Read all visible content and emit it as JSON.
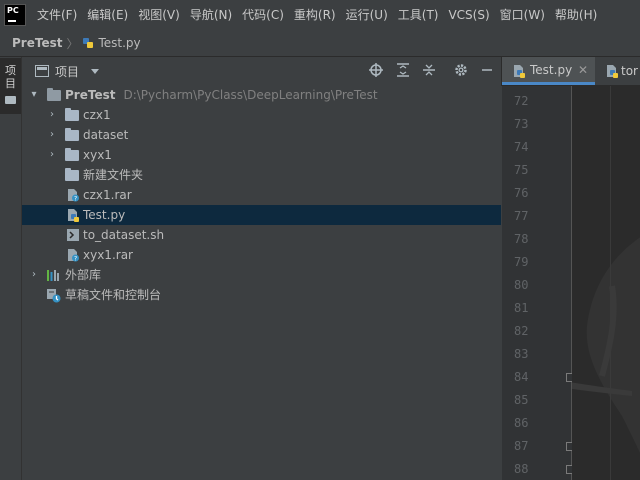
{
  "menubar": {
    "logo_text": "PC",
    "items": [
      "文件(F)",
      "编辑(E)",
      "视图(V)",
      "导航(N)",
      "代码(C)",
      "重构(R)",
      "运行(U)",
      "工具(T)",
      "VCS(S)",
      "窗口(W)",
      "帮助(H)"
    ]
  },
  "navbar": {
    "root": "PreTest",
    "file": "Test.py"
  },
  "left_strip": {
    "project_tab_label": "项目"
  },
  "project_panel": {
    "title": "项目",
    "toolbar_icons": [
      "crosshair-icon",
      "expand-all-icon",
      "collapse-all-icon",
      "gear-icon",
      "minimize-icon"
    ],
    "root": {
      "name": "PreTest",
      "path": "D:\\Pycharm\\PyClass\\DeepLearning\\PreTest"
    },
    "children": [
      {
        "name": "czx1",
        "type": "folder",
        "expandable": true
      },
      {
        "name": "dataset",
        "type": "folder",
        "expandable": true
      },
      {
        "name": "xyx1",
        "type": "folder",
        "expandable": true
      },
      {
        "name": "新建文件夹",
        "type": "folder",
        "expandable": false
      },
      {
        "name": "czx1.rar",
        "type": "unknown-file",
        "expandable": false
      },
      {
        "name": "Test.py",
        "type": "python-file",
        "expandable": false,
        "selected": true
      },
      {
        "name": "to_dataset.sh",
        "type": "shell-file",
        "expandable": false
      },
      {
        "name": "xyx1.rar",
        "type": "unknown-file",
        "expandable": false
      }
    ],
    "external_libraries": "外部库",
    "scratches": "草稿文件和控制台"
  },
  "editor": {
    "tabs": [
      {
        "label": "Test.py",
        "active": true
      },
      {
        "label": "tor",
        "active": false
      }
    ],
    "line_numbers": [
      "72",
      "73",
      "74",
      "75",
      "76",
      "77",
      "78",
      "79",
      "80",
      "81",
      "82",
      "83",
      "84",
      "85",
      "86",
      "87",
      "88"
    ]
  },
  "colors": {
    "background": "#3c3f41",
    "editor_bg": "#2b2b2b",
    "selection": "#0d293e",
    "active_tab_underline": "#4a88c7"
  }
}
